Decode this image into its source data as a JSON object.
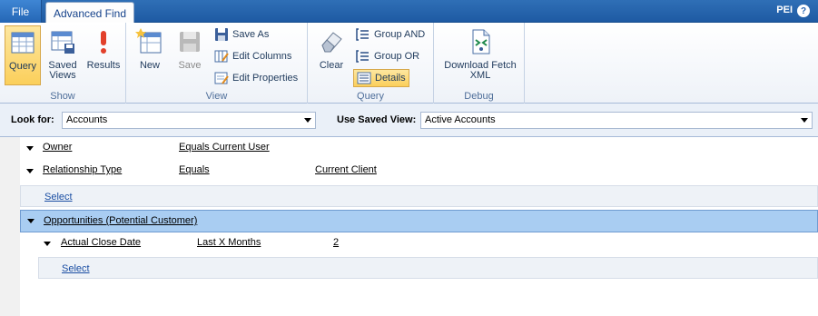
{
  "tabbar": {
    "file_label": "File",
    "active_tab": "Advanced Find",
    "user": "PEI"
  },
  "ribbon": {
    "groups": {
      "show": "Show",
      "view": "View",
      "query": "Query",
      "debug": "Debug"
    },
    "query_label": "Query",
    "saved_views_label": "Saved Views",
    "results_label": "Results",
    "new_label": "New",
    "save_label": "Save",
    "save_as_label": "Save As",
    "edit_columns_label": "Edit Columns",
    "edit_properties_label": "Edit Properties",
    "clear_label": "Clear",
    "group_and_label": "Group AND",
    "group_or_label": "Group OR",
    "details_label": "Details",
    "download_fetch_label": "Download Fetch XML"
  },
  "lookbar": {
    "look_for_label": "Look for:",
    "look_for_value": "Accounts",
    "saved_view_label": "Use Saved View:",
    "saved_view_value": "Active Accounts"
  },
  "criteria": {
    "rows": [
      {
        "field": "Owner",
        "operator": "Equals Current User",
        "value": ""
      },
      {
        "field": "Relationship Type",
        "operator": "Equals",
        "value": "Current Client"
      }
    ],
    "select_label": "Select",
    "related_entity": "Opportunities (Potential Customer)",
    "related_rows": [
      {
        "field": "Actual Close Date",
        "operator": "Last X Months",
        "value": "2"
      }
    ],
    "related_select_label": "Select"
  },
  "colors": {
    "accent": "#1e5aa3",
    "highlight": "#a9cdf2",
    "active_button": "#fbcf5b"
  }
}
